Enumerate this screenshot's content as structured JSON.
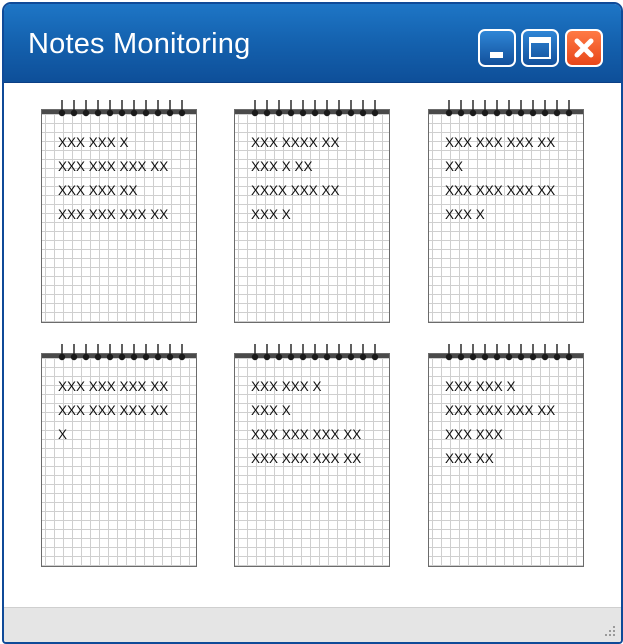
{
  "window": {
    "title": "Notes Monitoring",
    "controls": [
      "minimize",
      "maximize",
      "close"
    ],
    "accent_color": "#1565b8",
    "close_color": "#f1582a"
  },
  "notes": [
    {
      "lines": [
        "XXX XXX X",
        "XXX XXX XXX XX",
        "XXX XXX XX",
        "XXX XXX XXX XX"
      ]
    },
    {
      "lines": [
        "XXX XXXX XX",
        "XXX X XX",
        "XXXX XXX XX",
        "XXX X"
      ]
    },
    {
      "lines": [
        "XXX XXX XXX XX",
        "XX",
        "XXX XXX XXX XX",
        "XXX X"
      ]
    },
    {
      "lines": [
        "XXX XXX XXX XX",
        "XXX XXX XXX XX",
        "X"
      ]
    },
    {
      "lines": [
        "XXX XXX X",
        "XXX X",
        "XXX XXX XXX XX",
        "XXX XXX XXX XX"
      ]
    },
    {
      "lines": [
        "XXX XXX X",
        "XXX XXX XXX XX",
        "XXX XXX",
        "XXX XX"
      ]
    }
  ],
  "statusbar": {
    "grip_icon": "resize-grip-icon"
  }
}
